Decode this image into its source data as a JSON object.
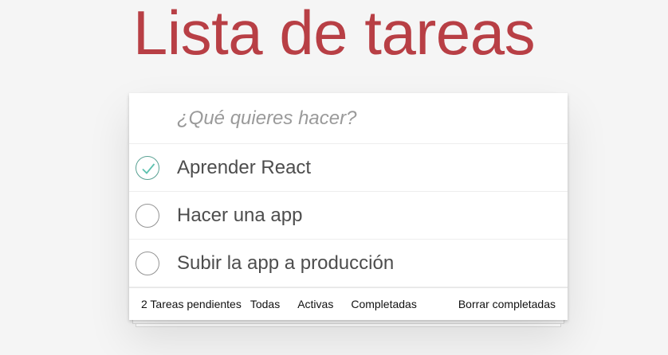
{
  "header": {
    "title": "Lista de tareas"
  },
  "new_todo": {
    "placeholder": "¿Qué quieres hacer?",
    "value": ""
  },
  "todos": [
    {
      "label": "Aprender React",
      "completed": true
    },
    {
      "label": "Hacer una app",
      "completed": false
    },
    {
      "label": "Subir la app a producción",
      "completed": false
    }
  ],
  "footer": {
    "count_text": "2 Tareas pendientes",
    "filters": [
      "Todas",
      "Activas",
      "Completadas"
    ],
    "clear_label": "Borrar completadas"
  },
  "colors": {
    "title": "#b83f45",
    "check": "#5dc2af",
    "background": "#f5f5f5"
  },
  "icons": {
    "completed_toggle": "check-circle-icon",
    "pending_toggle": "empty-circle-icon"
  }
}
